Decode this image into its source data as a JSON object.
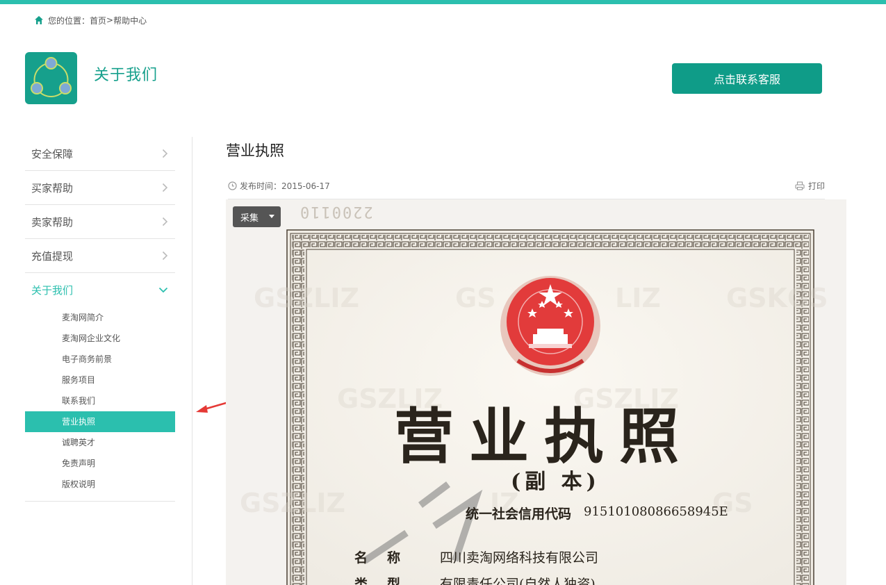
{
  "breadcrumb": {
    "prefix": "您的位置：",
    "home": "首页",
    "separator": " > ",
    "current": "帮助中心"
  },
  "header": {
    "title": "关于我们",
    "contact_button": "点击联系客服"
  },
  "sidebar": {
    "items": [
      {
        "label": "安全保障"
      },
      {
        "label": "买家帮助"
      },
      {
        "label": "卖家帮助"
      },
      {
        "label": "充值提现"
      },
      {
        "label": "关于我们"
      }
    ],
    "sub_items": [
      {
        "label": "麦淘网简介"
      },
      {
        "label": "麦淘网企业文化"
      },
      {
        "label": "电子商务前景"
      },
      {
        "label": "服务项目"
      },
      {
        "label": "联系我们"
      },
      {
        "label": "营业执照"
      },
      {
        "label": "诚聘英才"
      },
      {
        "label": "免责声明"
      },
      {
        "label": "版权说明"
      }
    ]
  },
  "article": {
    "title": "营业执照",
    "publish_label": "发布时间：",
    "publish_date": "2015-06-17",
    "print_label": "打印",
    "collect_label": "采集"
  },
  "license": {
    "serial": "2200110",
    "title": "营业执照",
    "subtitle": "(副 本)",
    "code_label": "统一社会信用代码",
    "code": "91510108086658945E",
    "name_label": "名称",
    "name": "四川卖淘网络科技有限公司",
    "type_label": "类型",
    "type": "有限责任公司(自然人独资)"
  },
  "colors": {
    "accent": "#2bbfae",
    "button": "#0f9c88",
    "logo_bg": "#16a08c"
  }
}
